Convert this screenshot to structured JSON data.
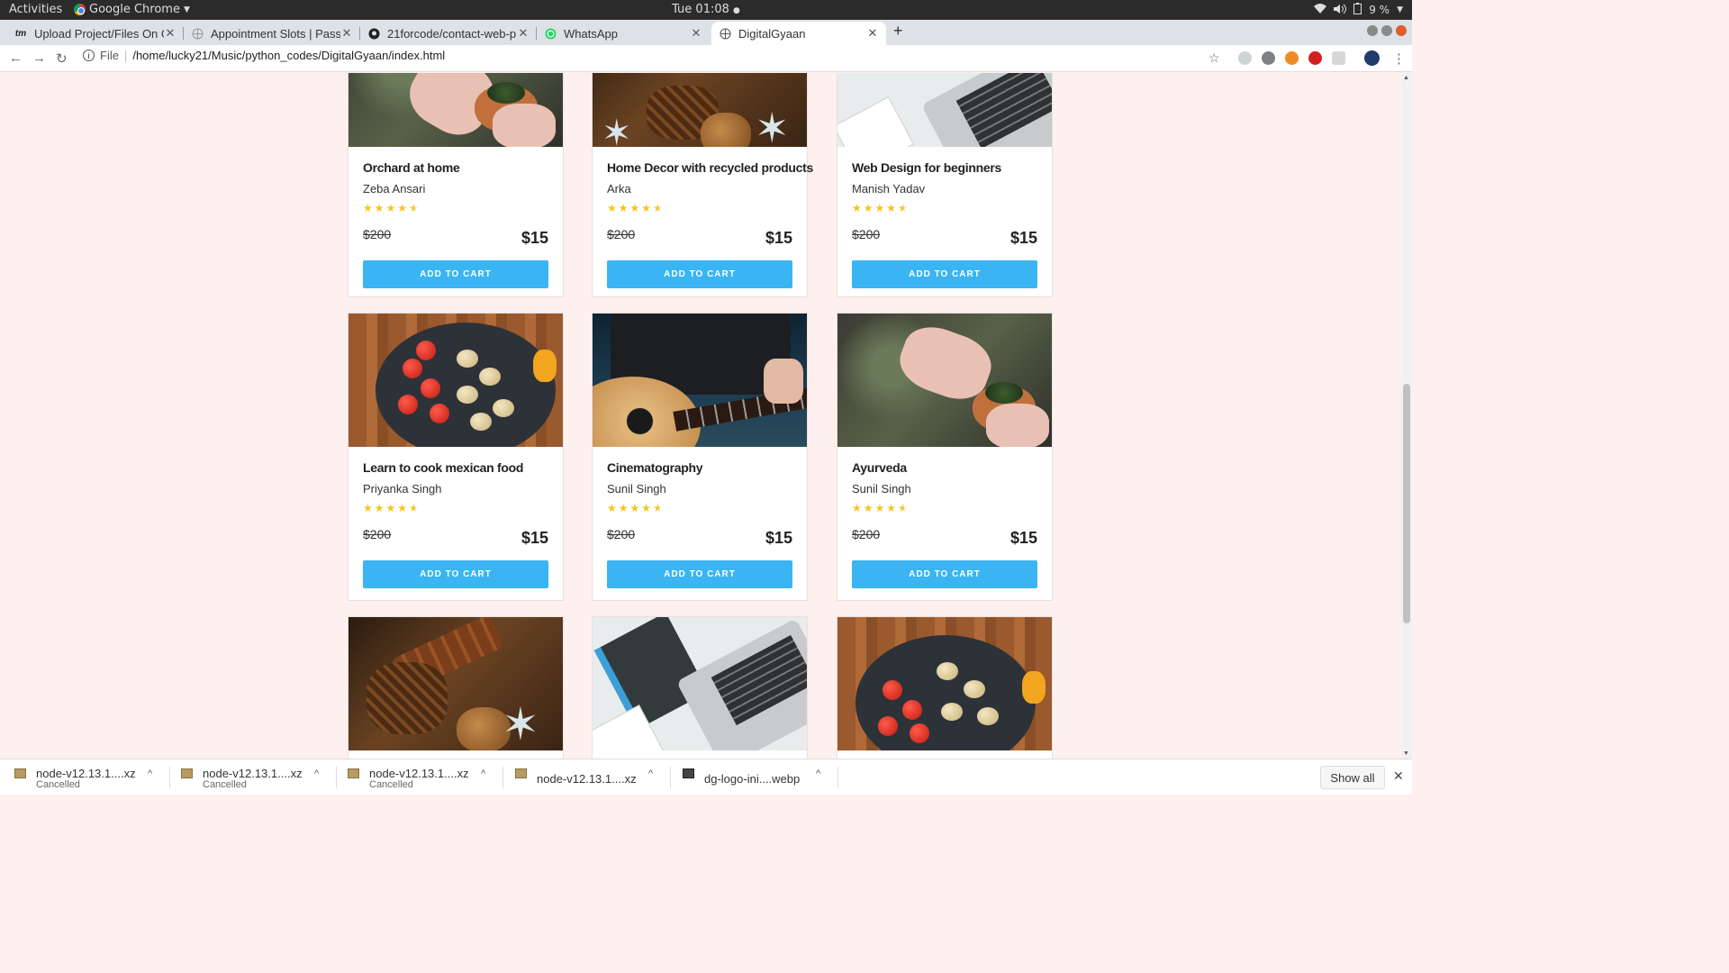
{
  "os_bar": {
    "activities": "Activities",
    "app_name": "Google Chrome",
    "clock": "Tue 01:08",
    "battery": "9 %"
  },
  "tabs": [
    {
      "title": "Upload Project/Files On G",
      "favicon": "tm"
    },
    {
      "title": "Appointment Slots | Pass",
      "favicon": "globe-icon"
    },
    {
      "title": "21forcode/contact-web-p",
      "favicon": "github-icon"
    },
    {
      "title": "WhatsApp",
      "favicon": "whatsapp-icon"
    },
    {
      "title": "DigitalGyaan",
      "favicon": "globe-icon",
      "active": true
    }
  ],
  "toolbar": {
    "scheme_label": "File",
    "url": "/home/lucky21/Music/python_codes/DigitalGyaan/index.html"
  },
  "courses": [
    {
      "title": "Orchard at home",
      "author": "Zeba Ansari",
      "rating": 4.5,
      "old_price": "$200",
      "price": "$15",
      "button": "ADD TO CART",
      "image": "pot-plant"
    },
    {
      "title": "Home Decor with recycled products",
      "author": "Arka",
      "rating": 4.5,
      "old_price": "$200",
      "price": "$15",
      "button": "ADD TO CART",
      "image": "pinecone-decor"
    },
    {
      "title": "Web Design for beginners",
      "author": "Manish Yadav",
      "rating": 4.5,
      "old_price": "$200",
      "price": "$15",
      "button": "ADD TO CART",
      "image": "laptop-desk"
    },
    {
      "title": "Learn to cook mexican food",
      "author": "Priyanka Singh",
      "rating": 4.5,
      "old_price": "$200",
      "price": "$15",
      "button": "ADD TO CART",
      "image": "vegetable-pan"
    },
    {
      "title": "Cinematography",
      "author": "Sunil Singh",
      "rating": 4.5,
      "old_price": "$200",
      "price": "$15",
      "button": "ADD TO CART",
      "image": "guitar"
    },
    {
      "title": "Ayurveda",
      "author": "Sunil Singh",
      "rating": 4.5,
      "old_price": "$200",
      "price": "$15",
      "button": "ADD TO CART",
      "image": "pot-plant"
    },
    {
      "image": "cinnamon-decor"
    },
    {
      "image": "html-css-book"
    },
    {
      "image": "vegetable-pan"
    }
  ],
  "downloads": [
    {
      "name": "node-v12.13.1....xz",
      "status": "Cancelled"
    },
    {
      "name": "node-v12.13.1....xz",
      "status": "Cancelled"
    },
    {
      "name": "node-v12.13.1....xz",
      "status": "Cancelled"
    },
    {
      "name": "node-v12.13.1....xz",
      "status": ""
    },
    {
      "name": "dg-logo-ini....webp",
      "status": ""
    }
  ],
  "shelf": {
    "show_all": "Show all"
  },
  "colors": {
    "accent": "#3ab4f2",
    "star": "#f5c518",
    "page_bg": "#fdf0ef"
  }
}
